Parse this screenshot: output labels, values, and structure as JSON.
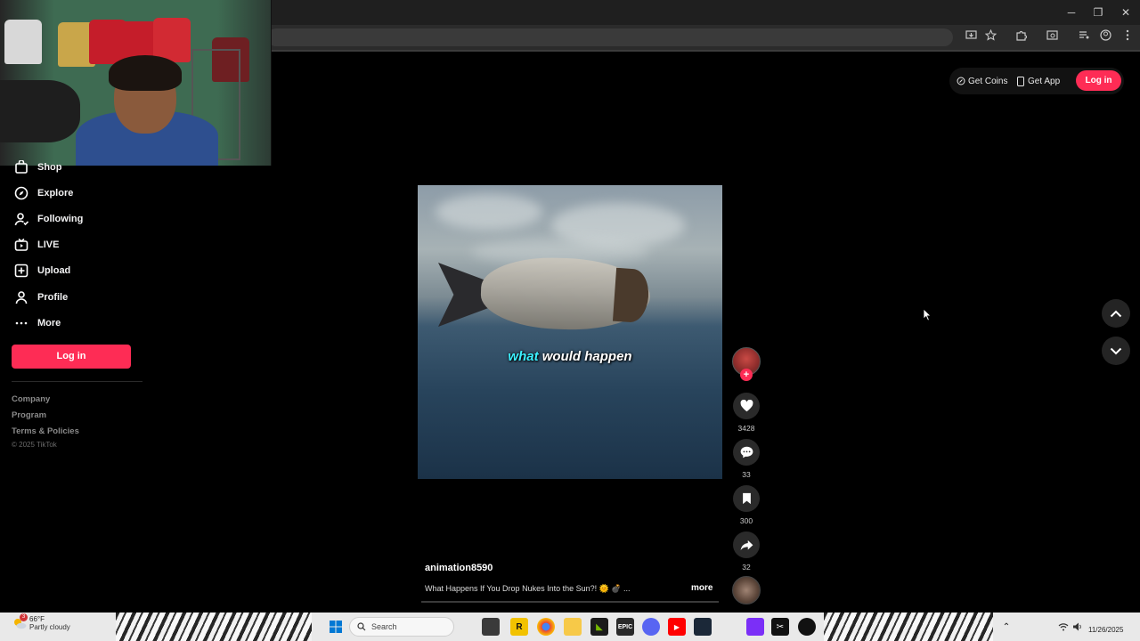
{
  "browser": {
    "window_controls": {
      "minimize": "─",
      "restore": "❐",
      "close": "✕"
    }
  },
  "sidebar": {
    "items": [
      {
        "label": "Shop",
        "icon": "shop-icon"
      },
      {
        "label": "Explore",
        "icon": "compass-icon"
      },
      {
        "label": "Following",
        "icon": "following-icon"
      },
      {
        "label": "LIVE",
        "icon": "live-icon"
      },
      {
        "label": "Upload",
        "icon": "upload-icon"
      },
      {
        "label": "Profile",
        "icon": "profile-icon"
      },
      {
        "label": "More",
        "icon": "more-icon"
      }
    ],
    "login_label": "Log in",
    "footer_links": [
      "Company",
      "Program",
      "Terms & Policies"
    ],
    "copyright": "© 2025 TikTok"
  },
  "header": {
    "get_coins": "Get Coins",
    "get_app": "Get App",
    "login": "Log in"
  },
  "video": {
    "caption_highlight": "what",
    "caption_rest": "would happen",
    "author": "animation8590",
    "description": "What Happens If You Drop Nukes Into the Sun?! 🌞 💣 ...",
    "more_label": "more",
    "likes": "3428",
    "comments": "33",
    "bookmarks": "300",
    "shares": "32"
  },
  "taskbar": {
    "weather_badge": "3",
    "weather_temp": "66°F",
    "weather_desc": "Partly cloudy",
    "search_placeholder": "Search",
    "date": "11/26/2025"
  },
  "colors": {
    "accent": "#fe2c55",
    "background": "#000000",
    "caption_highlight": "#3cf0ff"
  }
}
